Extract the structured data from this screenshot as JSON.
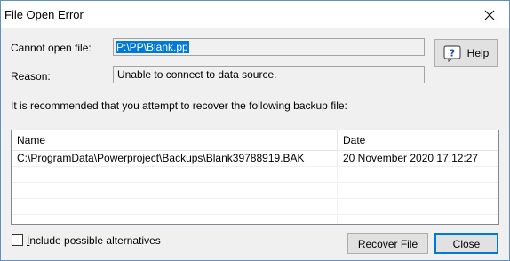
{
  "window": {
    "title": "File Open Error"
  },
  "cannot_open": {
    "label": "Cannot open file:",
    "value": "P:\\PP\\Blank.pp"
  },
  "reason": {
    "label": "Reason:",
    "value": "Unable to connect to data source."
  },
  "help_button": {
    "label": "Help"
  },
  "recommendation": "It is recommended that you attempt to recover the following backup file:",
  "backup_list": {
    "columns": [
      "Name",
      "Date"
    ],
    "rows": [
      {
        "name": "C:\\ProgramData\\Powerproject\\Backups\\Blank39788919.BAK",
        "date": "20 November 2020 17:12:27"
      }
    ]
  },
  "alternatives_checkbox": {
    "label_first": "I",
    "label_rest": "nclude possible alternatives",
    "checked": false
  },
  "recover_button": {
    "label_first": "R",
    "label_rest": "ecover File"
  },
  "close_button": {
    "label": "Close"
  }
}
